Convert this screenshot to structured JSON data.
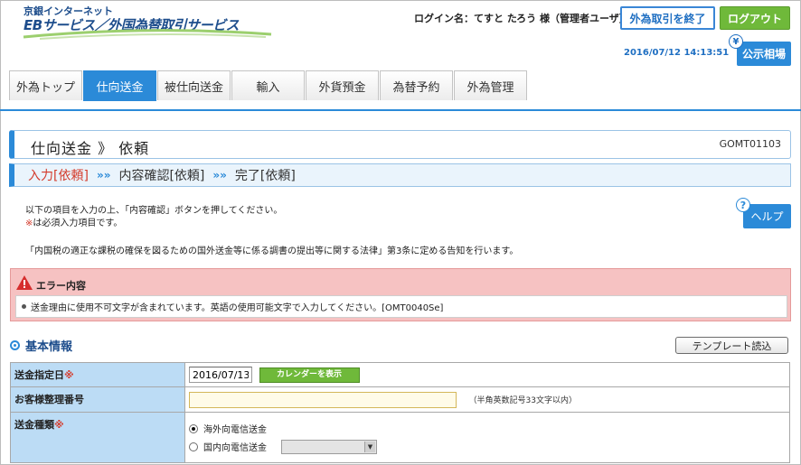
{
  "header": {
    "logo_line1": "京銀インターネット",
    "logo_line2": "EBサービス／外国為替取引サービス",
    "login_name": "ログイン名：てすと たろう 様（管理者ユーザ）",
    "exit_button": "外為取引を終了",
    "logout_button": "ログアウト",
    "datetime": "2016/07/12 14:13:51",
    "yen_icon": "¥",
    "rate_button": "公示相場"
  },
  "tabs": [
    {
      "label": "外為トップ",
      "active": false
    },
    {
      "label": "仕向送金",
      "active": true
    },
    {
      "label": "被仕向送金",
      "active": false
    },
    {
      "label": "輸入",
      "active": false
    },
    {
      "label": "外貨預金",
      "active": false
    },
    {
      "label": "為替予約",
      "active": false
    },
    {
      "label": "外為管理",
      "active": false
    }
  ],
  "page": {
    "title": "仕向送金 》 依頼",
    "screen_code": "GOMT01103"
  },
  "steps": {
    "current": "入力[依頼]",
    "separator": "»»",
    "step2": "内容確認[依頼]",
    "step3": "完了[依頼]"
  },
  "notes": {
    "line1": "以下の項目を入力の上、「内容確認」ボタンを押してください。",
    "required_mark": "※",
    "line2": "は必須入力項目です。",
    "line3": "「内国税の適正な課税の確保を図るための国外送金等に係る調書の提出等に関する法律」第3条に定める告知を行います。"
  },
  "help": {
    "q_icon": "?",
    "button": "ヘルプ"
  },
  "error": {
    "title": "エラー内容",
    "message": "送金理由に使用不可文字が含まれています。英語の使用可能文字で入力してください。[OMT0040Se]"
  },
  "section": {
    "title": "基本情報",
    "template_button": "テンプレート読込"
  },
  "form": {
    "required_mark": "※",
    "date_label": "送金指定日",
    "date_value": "2016/07/13",
    "calendar_button": "カレンダーを表示",
    "ref_label": "お客様整理番号",
    "ref_value": "",
    "ref_hint": "（半角英数記号33文字以内）",
    "type_label": "送金種類",
    "type_option1": "海外向電信送金",
    "type_option2": "国内向電信送金",
    "selected_type": "海外向電信送金",
    "domestic_select_value": ""
  },
  "colors": {
    "accent_blue": "#2b8ad8",
    "green": "#6fb93a",
    "error_bg": "#f6c2c2",
    "label_bg": "#bcdcf5",
    "required_red": "#d43b2b"
  }
}
